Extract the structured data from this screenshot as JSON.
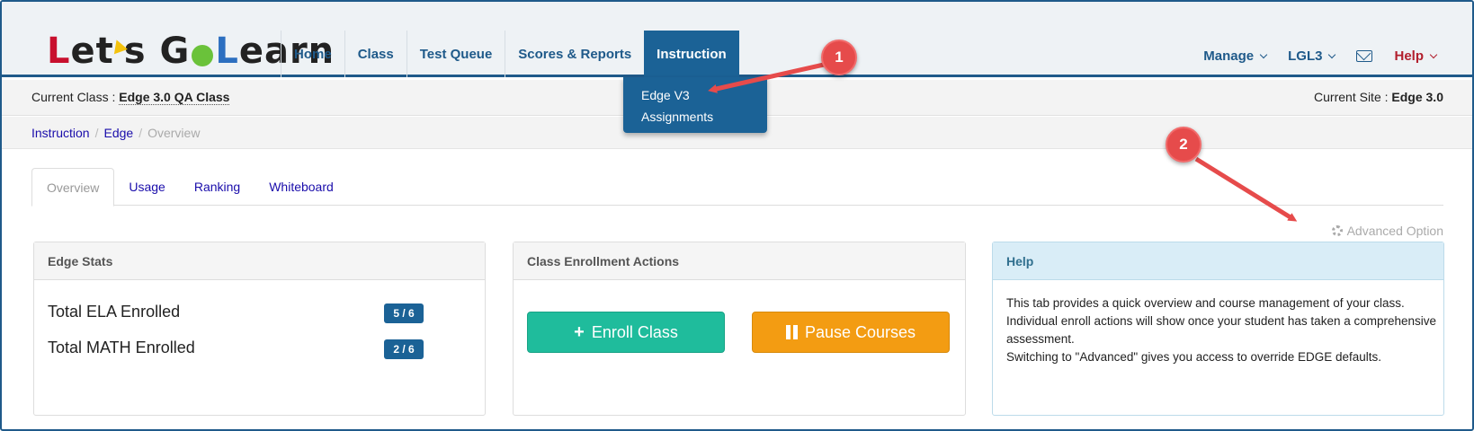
{
  "logo": {
    "text": "Let's Go Learn"
  },
  "nav": {
    "items": [
      {
        "label": "Home"
      },
      {
        "label": "Class"
      },
      {
        "label": "Test Queue"
      },
      {
        "label": "Scores & Reports"
      },
      {
        "label": "Instruction"
      }
    ],
    "active": "Instruction",
    "right": {
      "manage": "Manage",
      "account": "LGL3",
      "mail_icon": "envelope-icon",
      "help": "Help"
    }
  },
  "dropdown": {
    "items": [
      {
        "label": "Edge V3"
      },
      {
        "label": "Assignments"
      }
    ]
  },
  "class_bar": {
    "current_class_label": "Current Class : ",
    "current_class_value": "Edge 3.0 QA Class",
    "current_site_label": "Current Site : ",
    "current_site_value": "Edge 3.0"
  },
  "breadcrumb": {
    "items": [
      "Instruction",
      "Edge",
      "Overview"
    ],
    "separator": "/"
  },
  "tabs": [
    {
      "label": "Overview"
    },
    {
      "label": "Usage"
    },
    {
      "label": "Ranking"
    },
    {
      "label": "Whiteboard"
    }
  ],
  "active_tab": "Overview",
  "advanced_option": {
    "label": "Advanced Option",
    "icon": "gear-icon"
  },
  "panels": {
    "edge_stats": {
      "title": "Edge Stats",
      "rows": [
        {
          "label": "Total ELA Enrolled",
          "value": "5 / 6"
        },
        {
          "label": "Total MATH Enrolled",
          "value": "2 / 6"
        }
      ]
    },
    "enrollment": {
      "title": "Class Enrollment Actions",
      "enroll_label": "Enroll Class",
      "pause_label": "Pause Courses"
    },
    "help": {
      "title": "Help",
      "lines": [
        "This tab provides a quick overview and course management of your class.",
        "Individual enroll actions will show once your student has taken a comprehensive assessment.",
        "Switching to \"Advanced\" gives you access to override EDGE defaults."
      ]
    }
  },
  "annotations": {
    "callout_1": "1",
    "callout_2": "2"
  },
  "colors": {
    "primary": "#1b6296",
    "enroll": "#1fbc9c",
    "pause": "#f39c12",
    "callout": "#e64b4b",
    "help_red": "#b21f2d"
  }
}
